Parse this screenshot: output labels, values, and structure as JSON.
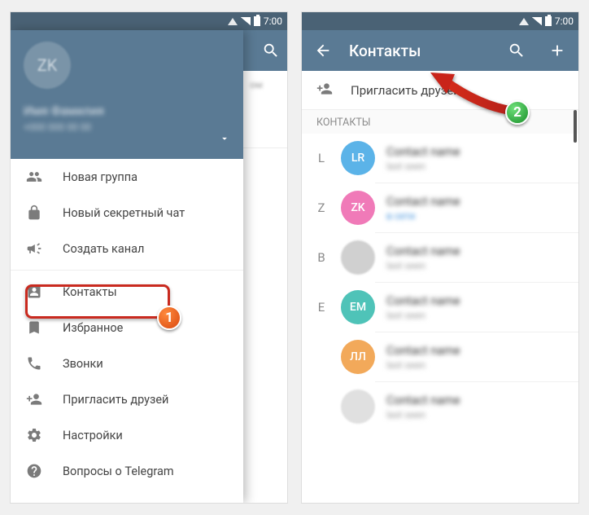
{
  "statusbar": {
    "time": "7:00"
  },
  "left": {
    "drawer": {
      "avatar_initials": "ZK",
      "name": "Имя Фамилия",
      "phone": "+000 000 00 00",
      "items": [
        {
          "label": "Новая группа",
          "icon": "group-icon"
        },
        {
          "label": "Новый секретный чат",
          "icon": "lock-icon"
        },
        {
          "label": "Создать канал",
          "icon": "megaphone-icon"
        },
        {
          "label": "Контакты",
          "icon": "contact-icon",
          "highlighted": true
        },
        {
          "label": "Избранное",
          "icon": "bookmark-icon"
        },
        {
          "label": "Звонки",
          "icon": "phone-icon"
        },
        {
          "label": "Пригласить друзей",
          "icon": "add-person-icon"
        },
        {
          "label": "Настройки",
          "icon": "gear-icon"
        },
        {
          "label": "Вопросы о Telegram",
          "icon": "help-icon"
        }
      ]
    },
    "behind_hint": "ом",
    "badge_number": "1"
  },
  "right": {
    "title": "Контакты",
    "invite_label": "Пригласить друзей",
    "section": "КОНТАКТЫ",
    "badge_number": "2",
    "contacts": [
      {
        "letter": "L",
        "initials": "LR",
        "avatar_color": "c-blue",
        "name": "Contact name",
        "status": "last seen"
      },
      {
        "letter": "Z",
        "initials": "ZK",
        "avatar_color": "c-pink",
        "name": "Contact name",
        "status": "в сети",
        "online": true
      },
      {
        "letter": "B",
        "initials": "",
        "avatar_color": "c-img",
        "name": "Contact name",
        "status": "last seen"
      },
      {
        "letter": "E",
        "initials": "EM",
        "avatar_color": "c-teal",
        "name": "Contact name",
        "status": "last seen"
      },
      {
        "letter": "",
        "initials": "ЛЛ",
        "avatar_color": "c-orange",
        "name": "Contact name",
        "status": "last seen"
      },
      {
        "letter": "",
        "initials": "",
        "avatar_color": "c-gray",
        "name": "Contact name",
        "status": "last seen"
      }
    ]
  }
}
